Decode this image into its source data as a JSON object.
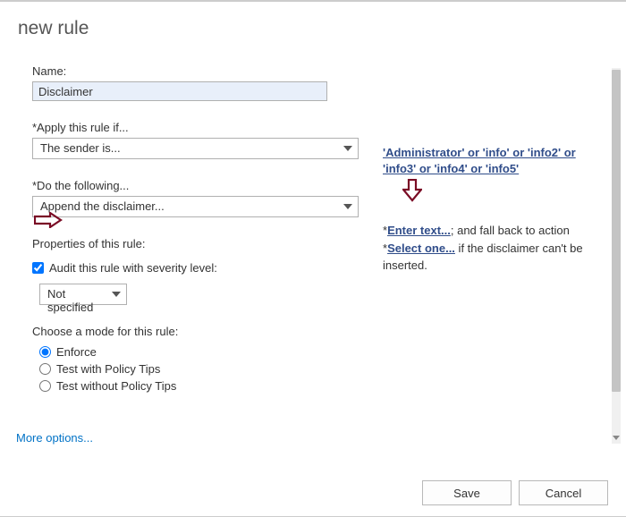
{
  "header": {
    "title": "new rule"
  },
  "form": {
    "name_label": "Name:",
    "name_value": "Disclaimer",
    "apply_label": "*Apply this rule if...",
    "apply_value": "The sender is...",
    "do_label": "*Do the following...",
    "do_value": "Append the disclaimer...",
    "properties_label": "Properties of this rule:",
    "audit_label": "Audit this rule with severity level:",
    "severity_value": "Not specified",
    "mode_label": "Choose a mode for this rule:",
    "mode_enforce": "Enforce",
    "mode_tips": "Test with Policy Tips",
    "mode_notips": "Test without Policy Tips",
    "more_options": "More options..."
  },
  "right": {
    "sender_list": "'Administrator' or 'info' or 'info2' or 'info3' or 'info4' or 'info5'",
    "prefix1": "*",
    "enter_text": "Enter text...",
    "mid": "; and fall back to action *",
    "select_one": "Select one...",
    "suffix": " if the disclaimer can't be inserted."
  },
  "footer": {
    "save": "Save",
    "cancel": "Cancel"
  }
}
